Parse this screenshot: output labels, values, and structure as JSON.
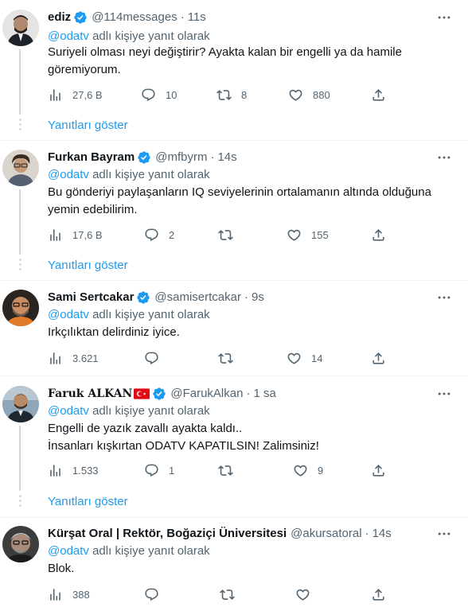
{
  "reply_prefix_suffix": " adlı kişiye yanıt olarak",
  "show_replies_label": "Yanıtları göster",
  "colors": {
    "accent": "#1d9bf0",
    "muted": "#536471",
    "verified": "#1d9bf0"
  },
  "tweets": [
    {
      "name": "ediz",
      "handle": "@114messages",
      "time": "11s",
      "reply_to": "@odatv",
      "lines": [
        "Suriyeli olması neyi değiştirir? Ayakta kalan bir engelli ya da hamile",
        "göremiyorum."
      ],
      "views": "27,6 B",
      "replies": "10",
      "retweets": "8",
      "likes": "880"
    },
    {
      "name": "Furkan Bayram",
      "handle": "@mfbyrm",
      "time": "14s",
      "reply_to": "@odatv",
      "lines": [
        "Bu gönderiyi paylaşanların IQ seviyelerinin ortalamanın altında olduğuna",
        "yemin edebilirim."
      ],
      "views": "17,6 B",
      "replies": "2",
      "retweets": "",
      "likes": "155"
    },
    {
      "name": "Sami Sertcakar",
      "handle": "@samisertcakar",
      "time": "9s",
      "reply_to": "@odatv",
      "lines": [
        "Irkçılıktan delirdiniz iyice."
      ],
      "views": "3.621",
      "replies": "",
      "retweets": "",
      "likes": "14"
    },
    {
      "name": "Faruk ALKAN",
      "handle": "@FarukAlkan",
      "time": "1 sa",
      "reply_to": "@odatv",
      "lines": [
        "Engelli de yazık zavallı ayakta kaldı..",
        "İnsanları kışkırtan ODATV KAPATILSIN! Zalimsiniz!"
      ],
      "views": "1.533",
      "replies": "1",
      "retweets": "",
      "likes": "9"
    },
    {
      "name": "Kürşat Oral | Rektör, Boğaziçi Üniversitesi",
      "handle": "@akursatoral",
      "time": "14s",
      "reply_to": "@odatv",
      "lines": [
        "Blok."
      ],
      "views": "388",
      "replies": "",
      "retweets": "",
      "likes": ""
    }
  ]
}
